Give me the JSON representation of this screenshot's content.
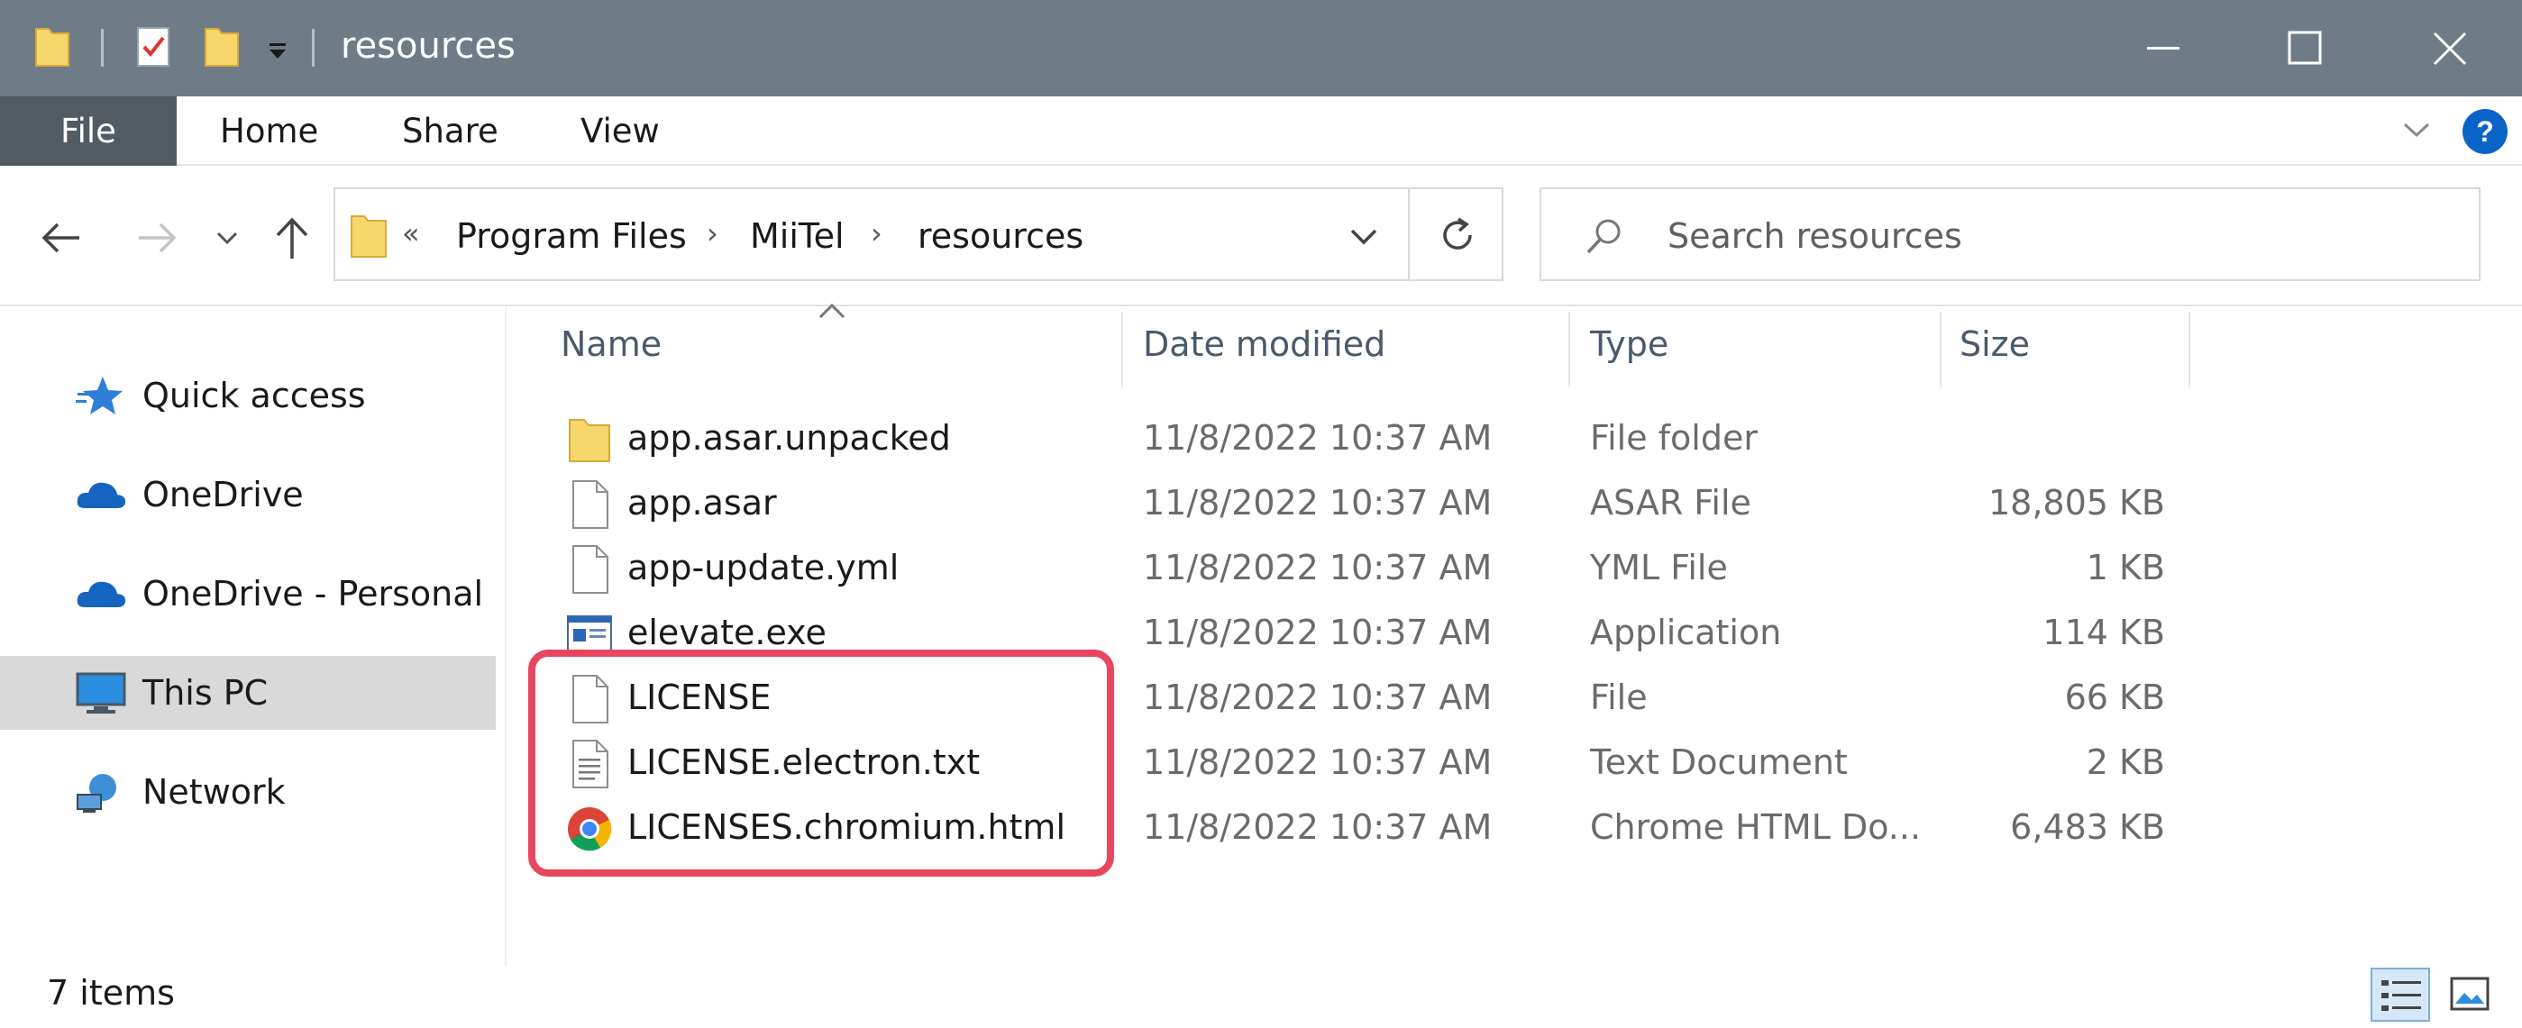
{
  "window": {
    "title": "resources",
    "controls": {
      "minimize_icon": "minimize-icon",
      "maximize_icon": "maximize-icon",
      "close_icon": "close-icon"
    }
  },
  "ribbon": {
    "tabs": [
      {
        "label": "File"
      },
      {
        "label": "Home"
      },
      {
        "label": "Share"
      },
      {
        "label": "View"
      }
    ]
  },
  "address": {
    "overflow": "«",
    "crumbs": [
      "Program Files",
      "MiiTel",
      "resources"
    ]
  },
  "search": {
    "placeholder": "Search resources"
  },
  "nav": {
    "items": [
      {
        "label": "Quick access",
        "icon": "star-icon"
      },
      {
        "label": "OneDrive",
        "icon": "cloud-icon"
      },
      {
        "label": "OneDrive - Personal",
        "icon": "cloud-icon"
      },
      {
        "label": "This PC",
        "icon": "computer-icon",
        "selected": true
      },
      {
        "label": "Network",
        "icon": "network-icon"
      }
    ]
  },
  "columns": {
    "name": "Name",
    "date": "Date modified",
    "type": "Type",
    "size": "Size"
  },
  "files": [
    {
      "name": "app.asar.unpacked",
      "date": "11/8/2022 10:37 AM",
      "type": "File folder",
      "size": "",
      "icon": "folder-icon"
    },
    {
      "name": "app.asar",
      "date": "11/8/2022 10:37 AM",
      "type": "ASAR File",
      "size": "18,805 KB",
      "icon": "file-icon"
    },
    {
      "name": "app-update.yml",
      "date": "11/8/2022 10:37 AM",
      "type": "YML File",
      "size": "1 KB",
      "icon": "file-icon"
    },
    {
      "name": "elevate.exe",
      "date": "11/8/2022 10:37 AM",
      "type": "Application",
      "size": "114 KB",
      "icon": "application-icon"
    },
    {
      "name": "LICENSE",
      "date": "11/8/2022 10:37 AM",
      "type": "File",
      "size": "66 KB",
      "icon": "file-icon"
    },
    {
      "name": "LICENSE.electron.txt",
      "date": "11/8/2022 10:37 AM",
      "type": "Text Document",
      "size": "2 KB",
      "icon": "text-file-icon"
    },
    {
      "name": "LICENSES.chromium.html",
      "date": "11/8/2022 10:37 AM",
      "type": "Chrome HTML Do...",
      "size": "6,483 KB",
      "icon": "chrome-icon"
    }
  ],
  "status": {
    "count": "7 items"
  },
  "colors": {
    "titlebar": "#6f7c87",
    "file_tab": "#525a62",
    "highlight": "#e8455f",
    "accent": "#0a64c8"
  }
}
